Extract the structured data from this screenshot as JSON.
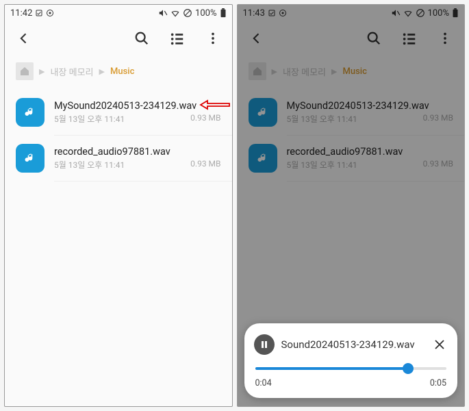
{
  "left": {
    "status": {
      "time": "11:42",
      "battery": "100%"
    },
    "breadcrumb": {
      "internal": "내장 메모리",
      "folder": "Music"
    },
    "files": [
      {
        "name": "MySound20240513-234129.wav",
        "date": "5월 13일 오후 11:41",
        "size": "0.93 MB"
      },
      {
        "name": "recorded_audio97881.wav",
        "date": "5월 13일 오후 11:41",
        "size": "0.93 MB"
      }
    ]
  },
  "right": {
    "status": {
      "time": "11:43",
      "battery": "100%"
    },
    "breadcrumb": {
      "internal": "내장 메모리",
      "folder": "Music"
    },
    "files": [
      {
        "name": "MySound20240513-234129.wav",
        "date": "5월 13일 오후 11:41",
        "size": "0.93 MB"
      },
      {
        "name": "recorded_audio97881.wav",
        "date": "5월 13일 오후 11:41",
        "size": "0.93 MB"
      }
    ],
    "player": {
      "title": "Sound20240513-234129.wav",
      "elapsed": "0:04",
      "total": "0:05",
      "progress_pct": 80
    }
  }
}
